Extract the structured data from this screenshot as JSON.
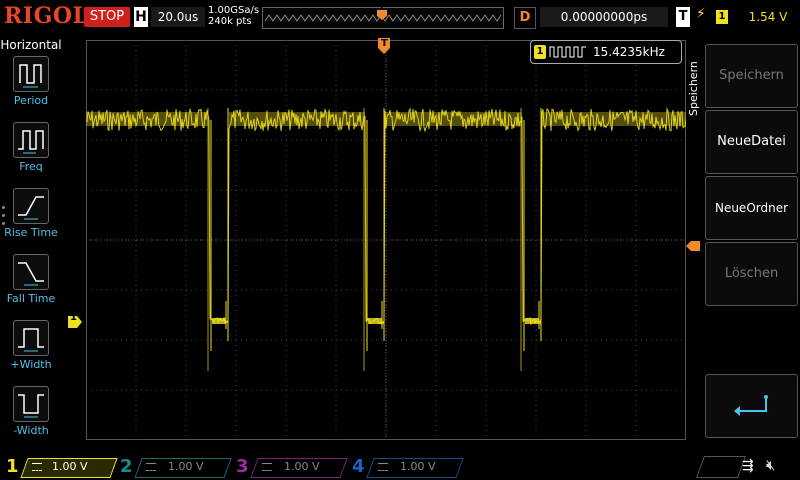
{
  "top": {
    "brand": "RIGOL",
    "run_state": "STOP",
    "h_label": "H",
    "timebase": "20.0us",
    "sample_rate": "1.00GSa/s",
    "memory_depth": "240k pts",
    "trig_pos_marker": "T",
    "d_label": "D",
    "delay": "0.00000000ps",
    "t_label": "T",
    "trigger_source": "1",
    "trigger_level": "1.54 V"
  },
  "left_menu": {
    "title": "Horizontal",
    "items": [
      {
        "label": "Period",
        "icon": "period-icon"
      },
      {
        "label": "Freq",
        "icon": "freq-icon"
      },
      {
        "label": "Rise Time",
        "icon": "rise-time-icon"
      },
      {
        "label": "Fall Time",
        "icon": "fall-time-icon"
      },
      {
        "label": "+Width",
        "icon": "pos-width-icon"
      },
      {
        "label": "-Width",
        "icon": "neg-width-icon"
      }
    ]
  },
  "display": {
    "trigger_marker": "T",
    "freq_channel": "1",
    "frequency": "15.4235kHz",
    "channel_marker": "1"
  },
  "right_menu": {
    "title": "Speichern",
    "buttons": [
      {
        "label": "Speichern",
        "enabled": false
      },
      {
        "label": "NeueDatei",
        "enabled": true
      },
      {
        "label": "NeueOrdner",
        "enabled": true
      },
      {
        "label": "Löschen",
        "enabled": false
      },
      {
        "label": "",
        "enabled": true,
        "icon": "enter-return-icon"
      }
    ]
  },
  "channels": [
    {
      "num": "1",
      "scale": "1.00 V",
      "color": "#f0e020",
      "active": true
    },
    {
      "num": "2",
      "scale": "1.00 V",
      "color": "#1a8a8a",
      "active": false
    },
    {
      "num": "3",
      "scale": "1.00 V",
      "color": "#a02aa0",
      "active": false
    },
    {
      "num": "4",
      "scale": "1.00 V",
      "color": "#2060c0",
      "active": false
    }
  ],
  "colors": {
    "trace": "#f0e020",
    "accent_orange": "#f08a2c",
    "menu_label": "#4fc0e8",
    "stop_red": "#d0201e"
  },
  "status_icons": [
    "usb-icon",
    "speaker-muted-icon"
  ]
}
